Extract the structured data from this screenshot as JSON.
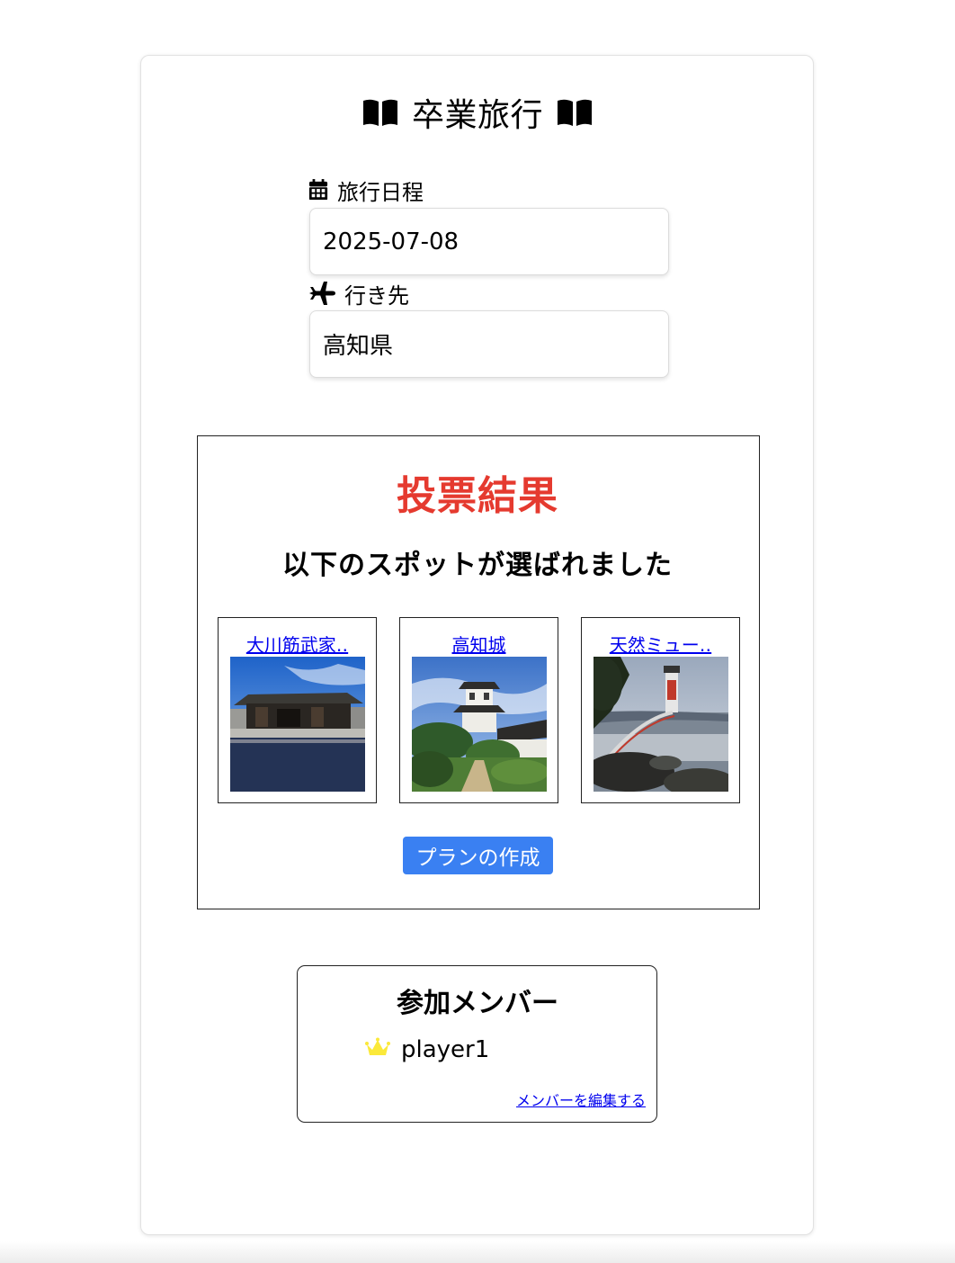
{
  "header": {
    "title": "卒業旅行",
    "left_icon": "book-open-icon",
    "right_icon": "book-open-icon"
  },
  "trip": {
    "date_label": "旅行日程",
    "date_icon": "calendar-icon",
    "date_value": "2025-07-08",
    "destination_label": "行き先",
    "destination_icon": "airplane-icon",
    "destination_value": "高知県"
  },
  "vote_result": {
    "title": "投票結果",
    "subtitle": "以下のスポットが選ばれました",
    "title_color": "#e53a2f",
    "spots": [
      {
        "name": "大川筋武家‥"
      },
      {
        "name": "高知城"
      },
      {
        "name": "天然ミュー‥"
      }
    ],
    "create_plan_label": "プランの作成",
    "button_color": "#3a80f2"
  },
  "members": {
    "title": "参加メンバー",
    "list": [
      {
        "name": "player1",
        "icon": "crown-icon"
      }
    ],
    "edit_label": "メンバーを編集する"
  }
}
